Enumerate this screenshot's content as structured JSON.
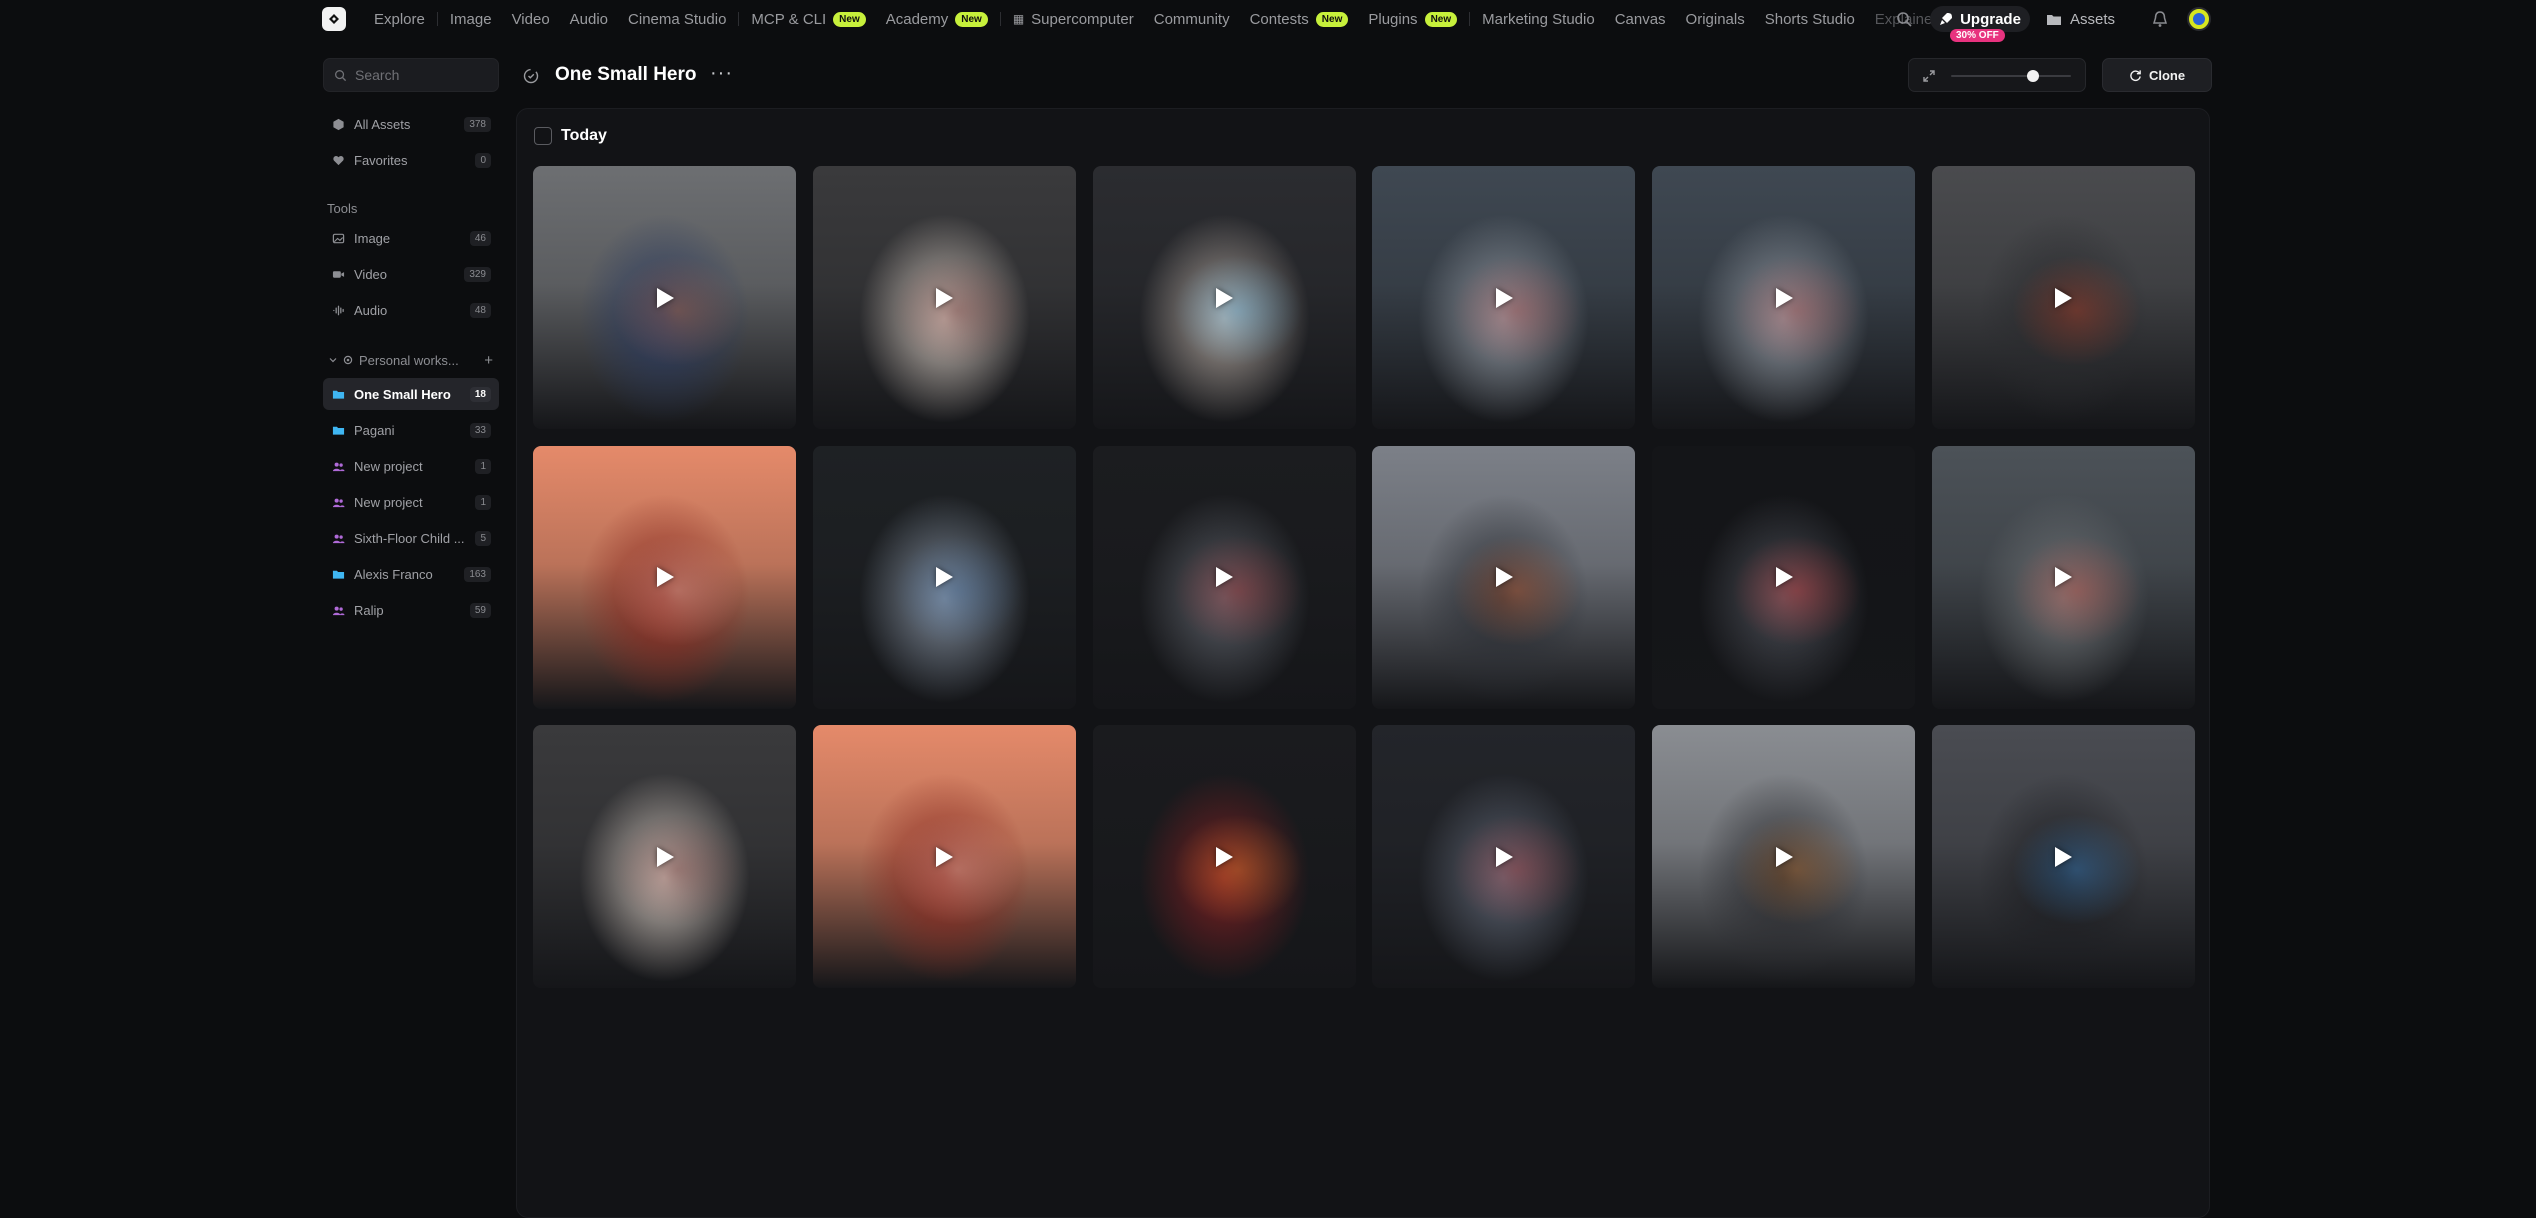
{
  "nav": {
    "items": [
      {
        "label": "Explore",
        "sep_after": true
      },
      {
        "label": "Image"
      },
      {
        "label": "Video"
      },
      {
        "label": "Audio"
      },
      {
        "label": "Cinema Studio",
        "sep_after": true
      },
      {
        "label": "MCP & CLI",
        "badge": "New"
      },
      {
        "label": "Academy",
        "badge": "New",
        "sep_after": true
      },
      {
        "label": "Supercomputer",
        "grid_icon": true
      },
      {
        "label": "Community"
      },
      {
        "label": "Contests",
        "badge": "New"
      },
      {
        "label": "Plugins",
        "badge": "New",
        "sep_after": true
      },
      {
        "label": "Marketing Studio"
      },
      {
        "label": "Canvas"
      },
      {
        "label": "Originals"
      },
      {
        "label": "Shorts Studio"
      },
      {
        "label": "Explaine",
        "faded": true
      }
    ],
    "upgrade_label": "Upgrade",
    "discount_badge": "30% OFF",
    "assets_label": "Assets"
  },
  "sidebar": {
    "search_placeholder": "Search",
    "library": [
      {
        "label": "All Assets",
        "count": "378",
        "icon": "cube-icon"
      },
      {
        "label": "Favorites",
        "count": "0",
        "icon": "heart-icon"
      }
    ],
    "tools_heading": "Tools",
    "tools": [
      {
        "label": "Image",
        "count": "46",
        "icon": "image-icon"
      },
      {
        "label": "Video",
        "count": "329",
        "icon": "video-icon"
      },
      {
        "label": "Audio",
        "count": "48",
        "icon": "audio-wave-icon"
      }
    ],
    "workspace_label": "Personal works...",
    "projects": [
      {
        "label": "One Small Hero",
        "count": "18",
        "icon": "folder-icon",
        "color": "#3fb6f2",
        "active": true
      },
      {
        "label": "Pagani",
        "count": "33",
        "icon": "folder-icon",
        "color": "#3fb6f2"
      },
      {
        "label": "New project",
        "count": "1",
        "icon": "people-icon",
        "color": "#b06ad8"
      },
      {
        "label": "New project",
        "count": "1",
        "icon": "people-icon",
        "color": "#b06ad8"
      },
      {
        "label": "Sixth-Floor Child ...",
        "count": "5",
        "icon": "people-icon",
        "color": "#b06ad8"
      },
      {
        "label": "Alexis Franco",
        "count": "163",
        "icon": "folder-icon",
        "color": "#3fb6f2"
      },
      {
        "label": "Ralip",
        "count": "59",
        "icon": "people-icon",
        "color": "#b06ad8"
      }
    ]
  },
  "main": {
    "title": "One Small Hero",
    "more_label": "···",
    "clone_label": "Clone",
    "zoom_level": 0.68,
    "section_label": "Today",
    "thumbnails": [
      {
        "name": "boy-running-street",
        "base": "#6d6f72",
        "accent": "#2b3b60",
        "glow": "#e2783a"
      },
      {
        "name": "skeletal-creature",
        "base": "#3a3a3c",
        "accent": "#c7bdb5",
        "glow": "#6a1a1a"
      },
      {
        "name": "armor-closeup-triangle",
        "base": "#2b2c30",
        "accent": "#a99f98",
        "glow": "#5ec5ff"
      },
      {
        "name": "alien-ship-overhead",
        "base": "#3f4852",
        "accent": "#8c939c",
        "glow": "#b83a34"
      },
      {
        "name": "alien-ship-overhead-2",
        "base": "#3f4852",
        "accent": "#8c939c",
        "glow": "#b83a34"
      },
      {
        "name": "robot-kneeling-street",
        "base": "#4a4b4e",
        "accent": "#2a2b2e",
        "glow": "#e34a2a"
      },
      {
        "name": "portal-creature",
        "base": "#e58a6a",
        "accent": "#8b2a20",
        "glow": "#ffe0d0"
      },
      {
        "name": "cyborg-lab",
        "base": "#1e2124",
        "accent": "#7f8a99",
        "glow": "#3b6aa0"
      },
      {
        "name": "mech-interior",
        "base": "#1b1c1f",
        "accent": "#5a5e66",
        "glow": "#c02a2a"
      },
      {
        "name": "mech-arm-sky",
        "base": "#7c8088",
        "accent": "#2c2f35",
        "glow": "#ff7a40"
      },
      {
        "name": "mech-reactor",
        "base": "#141518",
        "accent": "#4a4d55",
        "glow": "#ff3b3b"
      },
      {
        "name": "flying-hero-city",
        "base": "#4c5258",
        "accent": "#6b6f72",
        "glow": "#e24a3a"
      },
      {
        "name": "skeletal-creature-2",
        "base": "#3a3a3c",
        "accent": "#c7bdb5",
        "glow": "#6a1a1a"
      },
      {
        "name": "portal-creature-2",
        "base": "#e58a6a",
        "accent": "#8b2a20",
        "glow": "#ffe0d0"
      },
      {
        "name": "red-armor-suit",
        "base": "#1a1b1e",
        "accent": "#7a1f22",
        "glow": "#ff9a30"
      },
      {
        "name": "boy-in-cockpit",
        "base": "#23252a",
        "accent": "#5b6270",
        "glow": "#c83a3a"
      },
      {
        "name": "woman-and-robot",
        "base": "#8a8d92",
        "accent": "#2b2c30",
        "glow": "#e88b3a"
      },
      {
        "name": "fallen-mech",
        "base": "#4a4c52",
        "accent": "#1d1e22",
        "glow": "#4aa8ff"
      }
    ]
  }
}
